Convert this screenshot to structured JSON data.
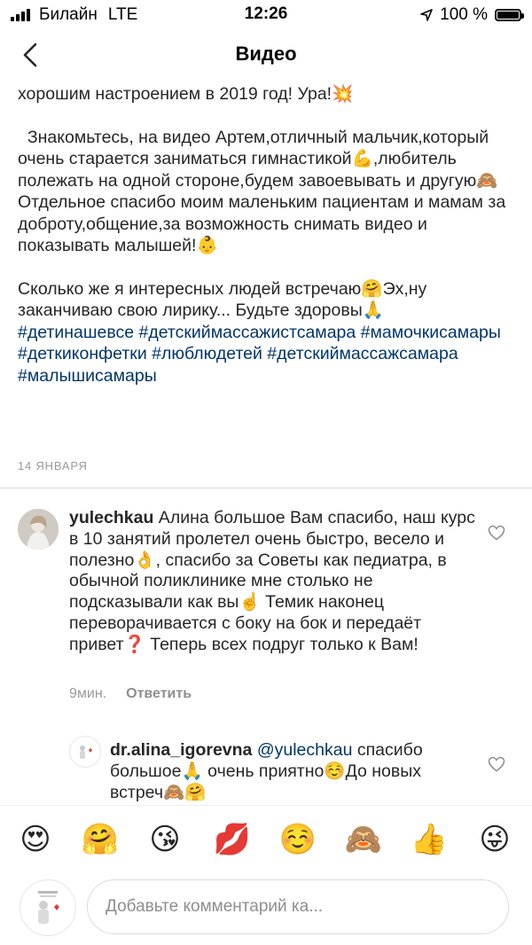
{
  "status_bar": {
    "carrier": "Билайн",
    "network": "LTE",
    "time": "12:26",
    "battery": "100 %",
    "battery_level": 1.0,
    "signal_bars": 4
  },
  "nav": {
    "title": "Видео"
  },
  "caption": {
    "line_top": "хорошим настроением в 2019 год! Ура!💥",
    "paragraph2": "  Знакомьтесь, на видео Артем,отличный мальчик,который очень старается заниматься гимнастикой💪,любитель полежать на одной стороне,будем завоевывать и другую🙈   Отдельное спасибо моим маленьким пациентам и мамам за доброту,общение,за возможность снимать видео и показывать малышей!👶",
    "paragraph3": "Сколько же я интересных людей встречаю🤗Эх,ну заканчиваю свою лирику... Будьте здоровы🙏",
    "hashtags": "#детинашевсе #детскиймассажистсамара #мамочкисамары #деткиконфетки #люблюдетей #детскиймассажсамара #малышисамары"
  },
  "date": "14 ЯНВАРЯ",
  "comments": [
    {
      "username": "yulechkau",
      "text": " Алина большое Вам спасибо, наш курс в 10 занятий пролетел очень быстро, весело и полезно👌, спасибо за Советы как педиатра, в обычной поликлинике мне столько не подсказывали как вы☝️ Темик наконец переворачивается с боку на бок и передаёт привет❓ Теперь всех подруг только к Вам!",
      "time": "9мин.",
      "reply": "Ответить"
    },
    {
      "username": "dr.alina_igorevna",
      "mention": "@yulechkau",
      "text": " спасибо большое🙏 очень приятно☺️До новых встреч🙈🤗"
    }
  ],
  "emoji_bar": [
    "😍",
    "🤗",
    "😘",
    "💋",
    "☺️",
    "🙈",
    "👍",
    "😜"
  ],
  "composer": {
    "placeholder": "Добавьте комментарий ка..."
  }
}
